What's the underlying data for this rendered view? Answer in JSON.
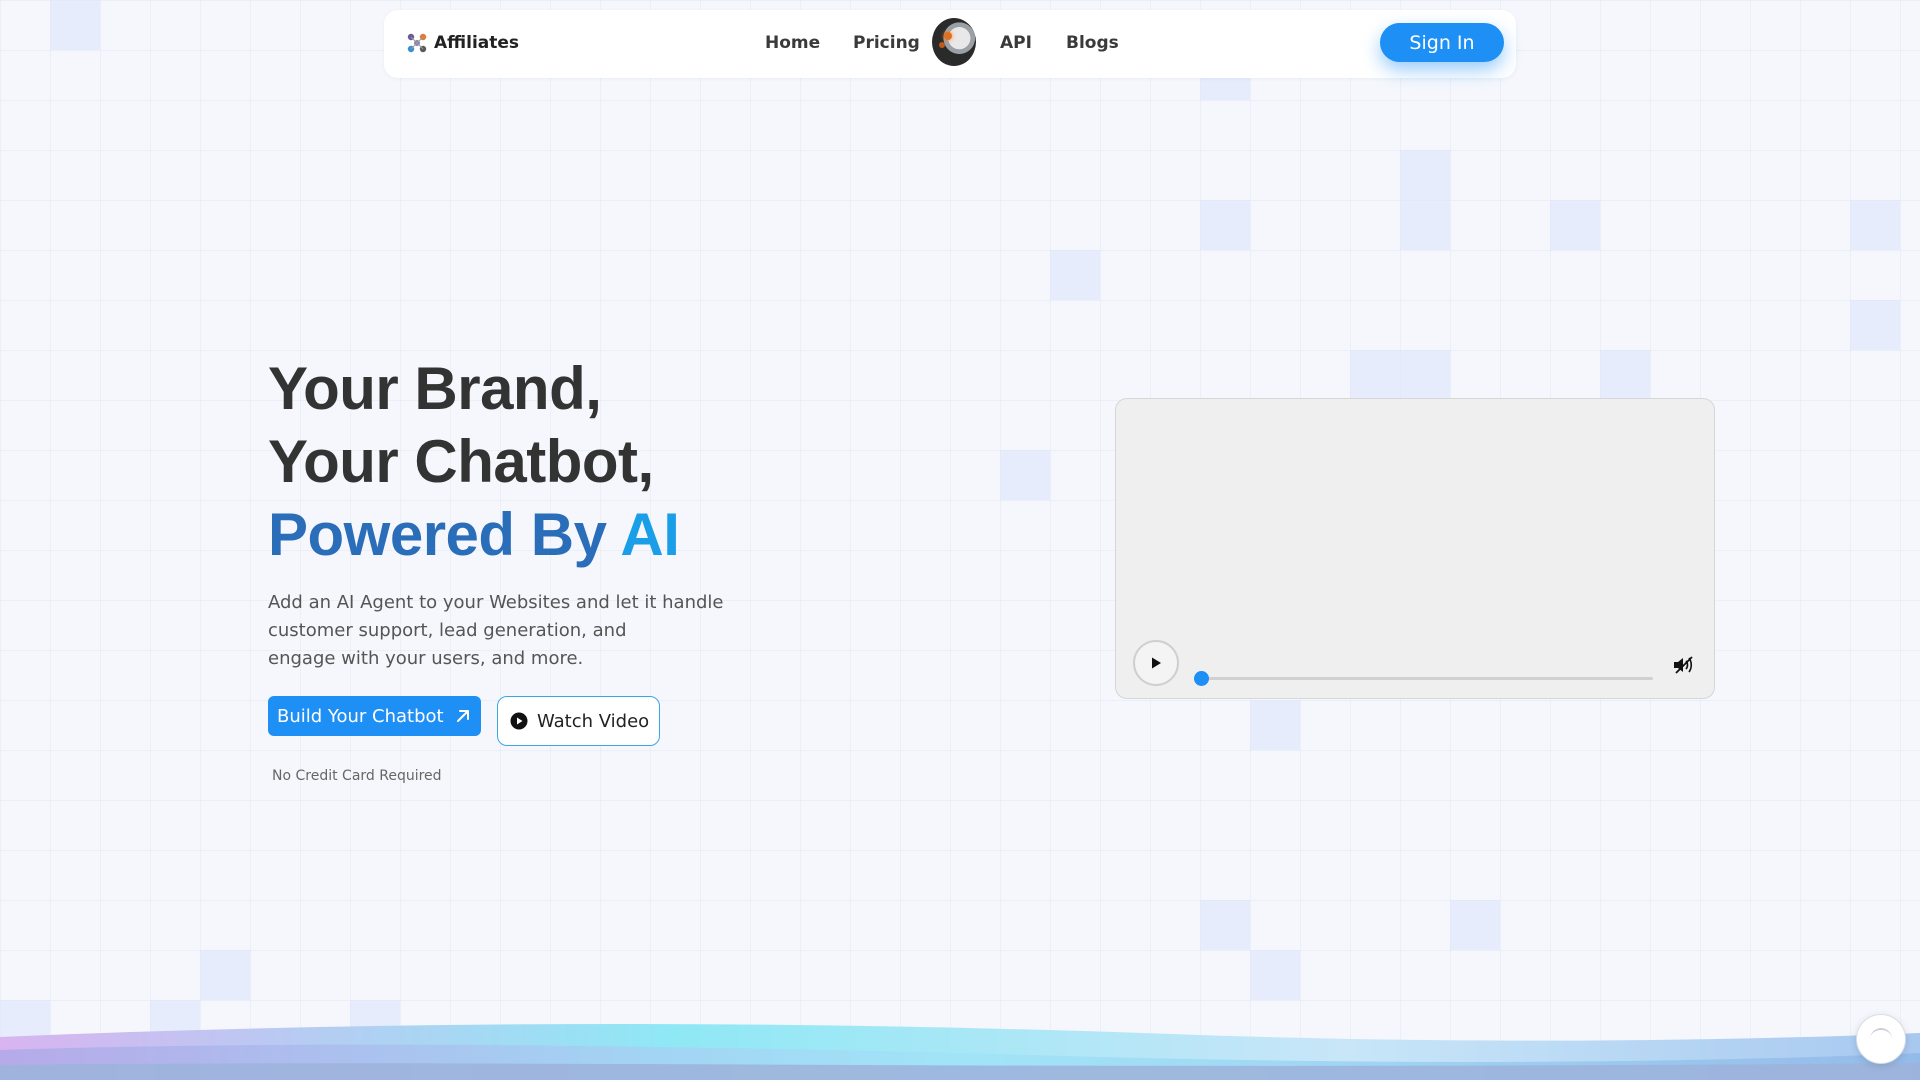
{
  "nav": {
    "brand": "Affiliates",
    "links": [
      "Home",
      "Pricing",
      "API",
      "Blogs"
    ],
    "sign_in": "Sign In"
  },
  "hero": {
    "line1": "Your Brand,",
    "line2": "Your Chatbot,",
    "line3_a": "Powered By ",
    "line3_b": "AI",
    "sub1": "Add an AI Agent to your Websites and let it handle",
    "sub2": "customer support, lead generation, and",
    "sub3": "engage with your users, and more.",
    "build_btn": "Build Your Chatbot",
    "watch_btn": "Watch Video",
    "note": "No Credit Card Required"
  },
  "video": {
    "progress": 0
  },
  "colors": {
    "accent": "#1d8ff5",
    "powered": "#2a6db8",
    "ai": "#1a9ee8"
  }
}
